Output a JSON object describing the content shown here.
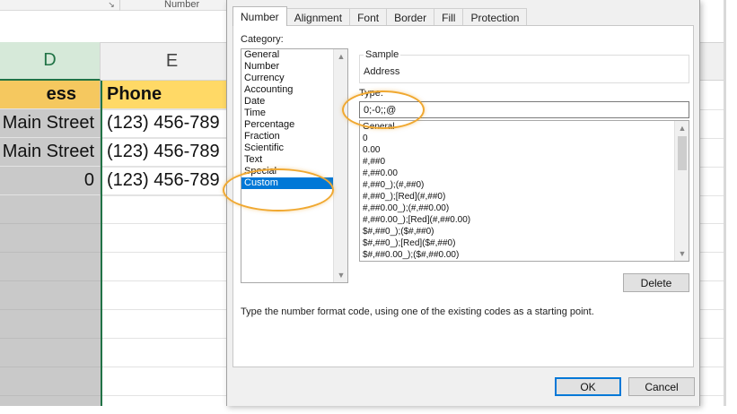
{
  "ribbon": {
    "expander_icon": "dialog-launcher-icon",
    "group_label": "Number"
  },
  "sheet": {
    "columns": [
      "D",
      "E"
    ],
    "rows": [
      {
        "d": "ess",
        "e": "Phone"
      },
      {
        "d": "Main Street",
        "e": "(123) 456-789"
      },
      {
        "d": "Main Street",
        "e": "(123) 456-789"
      },
      {
        "d": "0",
        "e": "(123) 456-789"
      }
    ],
    "colors": {
      "header_fill": "#ffd966",
      "selected_col": "#217346"
    }
  },
  "dialog": {
    "tabs": [
      "Number",
      "Alignment",
      "Font",
      "Border",
      "Fill",
      "Protection"
    ],
    "active_tab": "Number",
    "category_label": "Category:",
    "categories": [
      "General",
      "Number",
      "Currency",
      "Accounting",
      "Date",
      "Time",
      "Percentage",
      "Fraction",
      "Scientific",
      "Text",
      "Special",
      "Custom"
    ],
    "selected_category": "Custom",
    "sample_label": "Sample",
    "sample_value": "Address",
    "type_label": "Type:",
    "type_value": "0;-0;;@",
    "formats": [
      "General",
      "0",
      "0.00",
      "#,##0",
      "#,##0.00",
      "#,##0_);(#,##0)",
      "#,##0_);[Red](#,##0)",
      "#,##0.00_);(#,##0.00)",
      "#,##0.00_);[Red](#,##0.00)",
      "$#,##0_);($#,##0)",
      "$#,##0_);[Red]($#,##0)",
      "$#,##0.00_);($#,##0.00)"
    ],
    "delete_label": "Delete",
    "hint": "Type the number format code, using one of the existing codes as a starting point.",
    "ok_label": "OK",
    "cancel_label": "Cancel",
    "accent": "#0078d7"
  },
  "annotations": {
    "highlight_color": "#f0a830"
  }
}
